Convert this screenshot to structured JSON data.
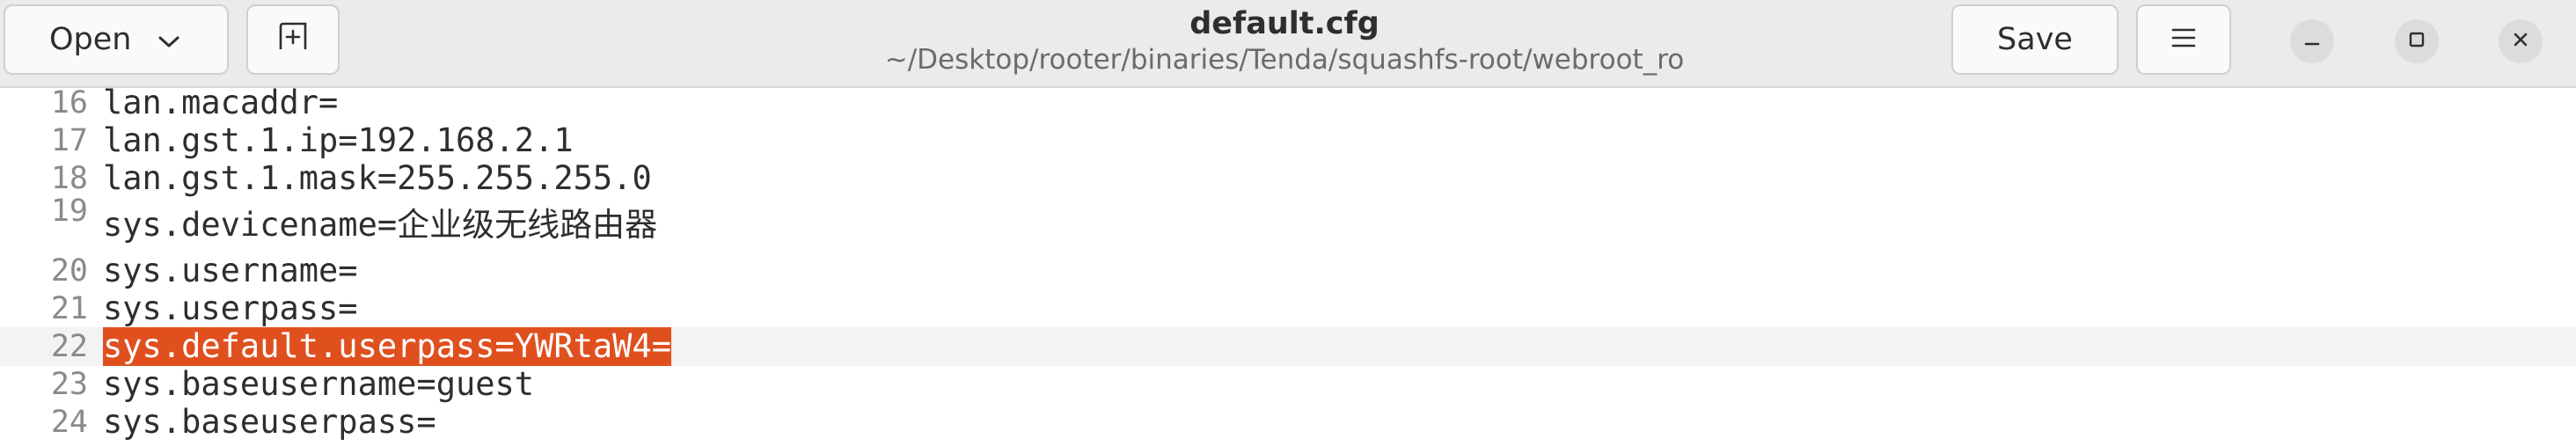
{
  "header": {
    "open_label": "Open",
    "title": "default.cfg",
    "subtitle": "~/Desktop/rooter/binaries/Tenda/squashfs-root/webroot_ro",
    "save_label": "Save"
  },
  "icons": {
    "open_dropdown": "chevron-down-icon",
    "new_tab": "new-tab-icon",
    "menu": "hamburger-menu-icon",
    "minimize": "minimize-icon",
    "maximize": "maximize-icon",
    "close": "close-icon"
  },
  "colors": {
    "selection": "#e0501f",
    "current_line": "#f3f3f3",
    "headerbar": "#ebebeb"
  },
  "editor": {
    "lines": [
      {
        "num": "16",
        "text": "lan.macaddr="
      },
      {
        "num": "17",
        "text": "lan.gst.1.ip=192.168.2.1"
      },
      {
        "num": "18",
        "text": "lan.gst.1.mask=255.255.255.0"
      },
      {
        "num": "19",
        "text": "sys.devicename=企业级无线路由器"
      },
      {
        "num": "20",
        "text": "sys.username="
      },
      {
        "num": "21",
        "text": "sys.userpass="
      },
      {
        "num": "22",
        "text": "sys.default.userpass=YWRtaW4="
      },
      {
        "num": "23",
        "text": "sys.baseusername=guest"
      },
      {
        "num": "24",
        "text": "sys.baseuserpass="
      }
    ]
  }
}
